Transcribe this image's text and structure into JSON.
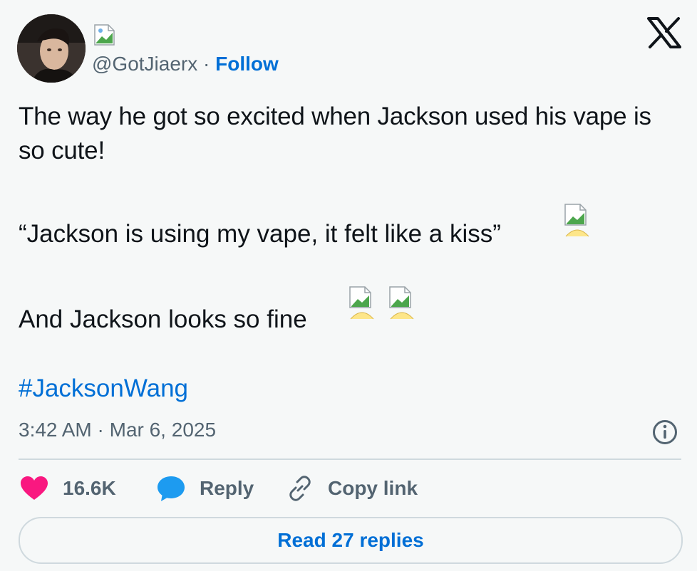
{
  "author": {
    "handle": "@GotJiaerx",
    "separator": "·",
    "follow_label": "Follow"
  },
  "tweet": {
    "paragraph1": "The way he got so excited when Jackson used his vape is so cute!",
    "paragraph2": "“Jackson is using my vape, it felt like a kiss”",
    "paragraph3": "And Jackson looks so fine",
    "hashtag": "#JacksonWang",
    "timestamp": "3:42 AM · Mar 6, 2025"
  },
  "actions": {
    "like_count": "16.6K",
    "reply_label": "Reply",
    "copy_label": "Copy link"
  },
  "read_replies_label": "Read 27 replies",
  "colors": {
    "accent": "#006fd6",
    "like": "#f91880",
    "reply": "#1d9bf0",
    "muted": "#536471"
  }
}
